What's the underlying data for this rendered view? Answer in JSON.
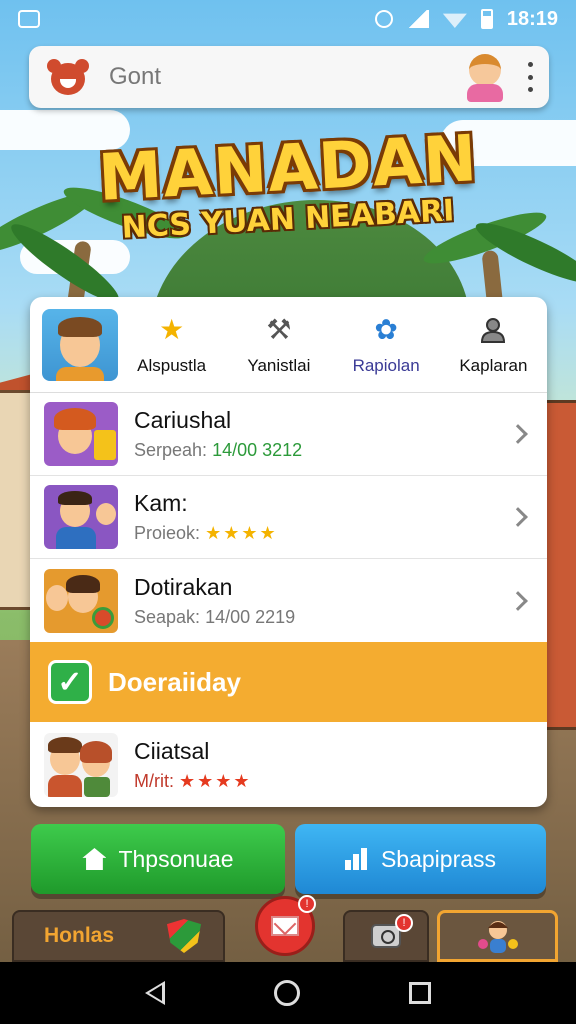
{
  "status_bar": {
    "time": "18:19"
  },
  "app_bar": {
    "title": "Gont"
  },
  "game": {
    "title": "MANADAN",
    "subtitle": "NCS YUAN NEABARI"
  },
  "tabs": [
    {
      "label": "Alspustla",
      "icon": "star-icon"
    },
    {
      "label": "Yanistlai",
      "icon": "hammer-icon"
    },
    {
      "label": "Rapiolan",
      "icon": "gear-icon",
      "active": true
    },
    {
      "label": "Kaplaran",
      "icon": "person-icon"
    }
  ],
  "list": [
    {
      "title": "Cariushal",
      "sub_prefix": "Serpeah:",
      "sub_value": "14/00 3212"
    },
    {
      "title": "Kam:",
      "sub_prefix": "Proieok:",
      "stars": "★★★★"
    },
    {
      "title": "Dotirakan",
      "sub_prefix": "Seapak:",
      "sub_value": "14/00 2219"
    }
  ],
  "highlight": {
    "label": "Doeraiiday"
  },
  "last_item": {
    "title": "Ciiatsal",
    "sub_prefix": "M/rit:",
    "stars": "★★★★"
  },
  "buttons": {
    "green": "Thpsonuae",
    "blue": "Sbapiprass"
  },
  "tray": {
    "left_label": "Honlas",
    "mail_badge": "!",
    "camera_badge": "!"
  },
  "colors": {
    "accent_orange": "#f4ac30",
    "green": "#2fb048",
    "blue": "#1f88d4",
    "title_gold": "#ffd23a"
  }
}
